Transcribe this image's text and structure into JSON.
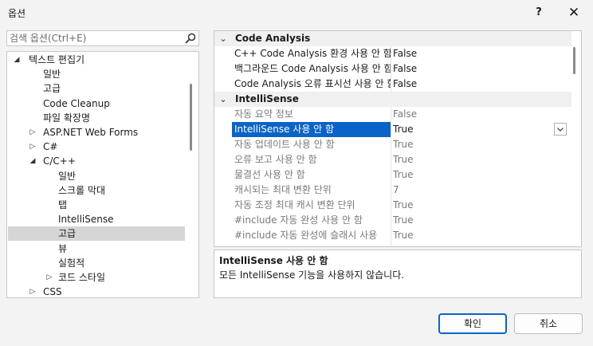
{
  "window": {
    "title": "옵션",
    "help": "?",
    "close": "✕"
  },
  "search": {
    "placeholder": "검색 옵션(Ctrl+E)"
  },
  "tree": [
    {
      "label": "텍스트 편집기",
      "level": 0,
      "arrow": "expanded",
      "selected": false
    },
    {
      "label": "일반",
      "level": 1,
      "arrow": "none",
      "selected": false
    },
    {
      "label": "고급",
      "level": 1,
      "arrow": "none",
      "selected": false
    },
    {
      "label": "Code Cleanup",
      "level": 1,
      "arrow": "none",
      "selected": false
    },
    {
      "label": "파일 확장명",
      "level": 1,
      "arrow": "none",
      "selected": false
    },
    {
      "label": "ASP.NET Web Forms",
      "level": 1,
      "arrow": "collapsed",
      "selected": false
    },
    {
      "label": "C#",
      "level": 1,
      "arrow": "collapsed",
      "selected": false
    },
    {
      "label": "C/C++",
      "level": 1,
      "arrow": "expanded",
      "selected": false
    },
    {
      "label": "일반",
      "level": 2,
      "arrow": "none",
      "selected": false
    },
    {
      "label": "스크롤 막대",
      "level": 2,
      "arrow": "none",
      "selected": false
    },
    {
      "label": "탭",
      "level": 2,
      "arrow": "none",
      "selected": false
    },
    {
      "label": "IntelliSense",
      "level": 2,
      "arrow": "none",
      "selected": false
    },
    {
      "label": "고급",
      "level": 2,
      "arrow": "none",
      "selected": true
    },
    {
      "label": "뷰",
      "level": 2,
      "arrow": "none",
      "selected": false
    },
    {
      "label": "실험적",
      "level": 2,
      "arrow": "none",
      "selected": false
    },
    {
      "label": "코드 스타일",
      "level": 2,
      "arrow": "collapsed",
      "selected": false
    },
    {
      "label": "CSS",
      "level": 1,
      "arrow": "collapsed",
      "selected": false
    }
  ],
  "grid": {
    "rows": [
      {
        "kind": "category",
        "name": "Code Analysis"
      },
      {
        "kind": "prop",
        "name": "C++ Code Analysis 환경 사용 안 함",
        "value": "False",
        "dim": false,
        "selected": false
      },
      {
        "kind": "prop",
        "name": "백그라운드 Code Analysis 사용 안 함",
        "value": "False",
        "dim": false,
        "selected": false
      },
      {
        "kind": "prop",
        "name": "Code Analysis 오류 표시선 사용 안 함",
        "value": "False",
        "dim": false,
        "selected": false
      },
      {
        "kind": "category",
        "name": "IntelliSense"
      },
      {
        "kind": "prop",
        "name": "자동 요약 정보",
        "value": "False",
        "dim": true,
        "selected": false
      },
      {
        "kind": "prop",
        "name": "IntelliSense 사용 안 함",
        "value": "True",
        "dim": false,
        "selected": true
      },
      {
        "kind": "prop",
        "name": "자동 업데이트 사용 안 함",
        "value": "True",
        "dim": true,
        "selected": false
      },
      {
        "kind": "prop",
        "name": "오류 보고 사용 안 함",
        "value": "True",
        "dim": true,
        "selected": false
      },
      {
        "kind": "prop",
        "name": "물결선 사용 안 함",
        "value": "True",
        "dim": true,
        "selected": false
      },
      {
        "kind": "prop",
        "name": "캐시되는 최대 변환 단위",
        "value": "7",
        "dim": true,
        "selected": false
      },
      {
        "kind": "prop",
        "name": "자동 조정 최대 캐시 변환 단위",
        "value": "True",
        "dim": true,
        "selected": false
      },
      {
        "kind": "prop",
        "name": "#include 자동 완성 사용 안 함",
        "value": "True",
        "dim": true,
        "selected": false
      },
      {
        "kind": "prop",
        "name": "#include 자동 완성에 슬래시 사용",
        "value": "True",
        "dim": true,
        "selected": false
      }
    ]
  },
  "description": {
    "title": "IntelliSense 사용 안 함",
    "text": "모든 IntelliSense 기능을 사용하지 않습니다."
  },
  "buttons": {
    "ok": "확인",
    "cancel": "취소"
  }
}
